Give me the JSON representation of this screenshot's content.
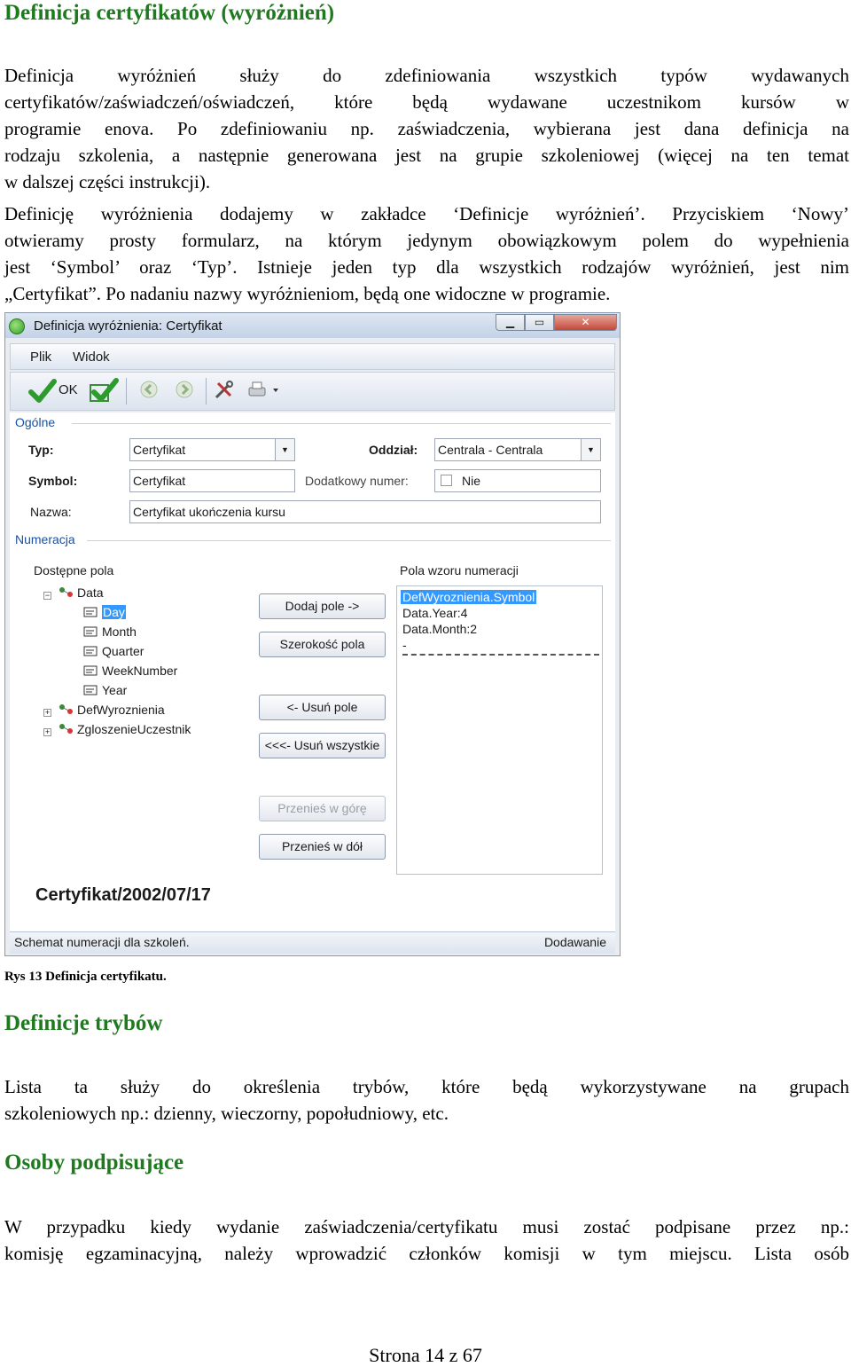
{
  "section1": {
    "heading": "Definicja certyfikatów (wyróżnień)",
    "para1_lines": [
      "Definicja wyróżnień służy do zdefiniowania wszystkich typów wydawanych",
      "certyfikatów/zaświadczeń/oświadczeń, które będą wydawane uczestnikom kursów w",
      "programie enova. Po zdefiniowaniu np. zaświadczenia, wybierana jest dana definicja na",
      "rodzaju szkolenia, a następnie generowana jest na grupie szkoleniowej (więcej na ten temat",
      "w dalszej części instrukcji)."
    ],
    "para2_lines": [
      "Definicję wyróżnienia dodajemy w zakładce ‘Definicje wyróżnień’. Przyciskiem ‘Nowy’",
      "otwieramy prosty formularz, na którym jedynym obowiązkowym polem do wypełnienia",
      "jest ‘Symbol’ oraz ‘Typ’. Istnieje jeden typ dla wszystkich rodzajów wyróżnień, jest nim",
      "„Certyfikat”. Po nadaniu nazwy wyróżnieniom, będą one widoczne w programie."
    ]
  },
  "window": {
    "title": "Definicja wyróżnienia: Certyfikat",
    "menu": [
      "Plik",
      "Widok"
    ],
    "toolbar": {
      "ok_label": "OK"
    },
    "group_general": "Ogólne",
    "typ_label": "Typ:",
    "typ_value": "Certyfikat",
    "oddzial_label": "Oddział:",
    "oddzial_value": "Centrala - Centrala",
    "symbol_label": "Symbol:",
    "symbol_value": "Certyfikat",
    "dodatkowy_label": "Dodatkowy numer:",
    "dodatkowy_value": "Nie",
    "nazwa_label": "Nazwa:",
    "nazwa_value": "Certyfikat ukończenia kursu",
    "group_numeracja": "Numeracja",
    "available_label": "Dostępne pola",
    "pattern_label": "Pola wzoru numeracji",
    "tree": [
      "Data",
      "Day",
      "Month",
      "Quarter",
      "WeekNumber",
      "Year",
      "DefWyroznienia",
      "ZgloszenieUczestnik"
    ],
    "buttons": {
      "add": "Dodaj pole ->",
      "width": "Szerokość pola",
      "remove": "<- Usuń pole",
      "remove_all": "<<<- Usuń wszystkie",
      "move_up": "Przenieś w górę",
      "move_down": "Przenieś w dół"
    },
    "pattern_items": [
      "DefWyroznienia.Symbol",
      "Data.Year:4",
      "Data.Month:2",
      "-"
    ],
    "preview": "Certyfikat/2002/07/17",
    "status_left": "Schemat numeracji dla szkoleń.",
    "status_right": "Dodawanie"
  },
  "caption": "Rys 13 Definicja certyfikatu.",
  "section2": {
    "heading": "Definicje trybów",
    "lines": [
      "Lista ta służy do określenia trybów, które będą wykorzystywane na grupach",
      "szkoleniowych np.: dzienny, wieczorny, popołudniowy, etc."
    ]
  },
  "section3": {
    "heading": "Osoby podpisujące",
    "lines": [
      "W przypadku kiedy wydanie zaświadczenia/certyfikatu musi zostać podpisane przez np.:",
      "komisję egzaminacyjną, należy wprowadzić członków komisji w tym miejscu. Lista osób"
    ]
  },
  "footer": "Strona 14 z 67"
}
